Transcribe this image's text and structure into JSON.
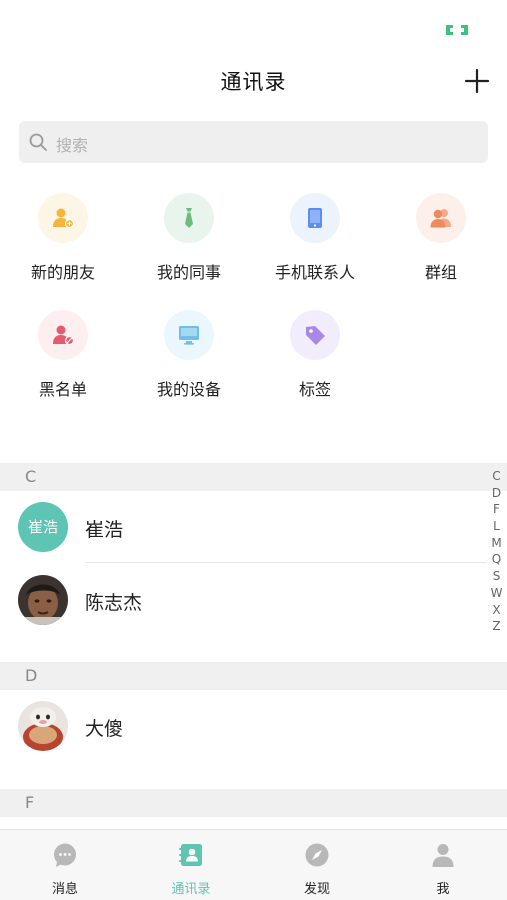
{
  "header": {
    "title": "通讯录"
  },
  "search": {
    "placeholder": "搜索"
  },
  "quick_grid": [
    {
      "label": "新的朋友",
      "icon": "new-friend-icon",
      "color": "#f5b43c",
      "bg": "#fdf6e6"
    },
    {
      "label": "我的同事",
      "icon": "colleague-tie-icon",
      "color": "#6fbb7e",
      "bg": "#e9f5ec"
    },
    {
      "label": "手机联系人",
      "icon": "phone-contacts-icon",
      "color": "#5b8ef0",
      "bg": "#edf3fd"
    },
    {
      "label": "群组",
      "icon": "group-icon",
      "color": "#ee8a5c",
      "bg": "#fdf0ea"
    },
    {
      "label": "黑名单",
      "icon": "blacklist-icon",
      "color": "#e65b6e",
      "bg": "#fdeef0"
    },
    {
      "label": "我的设备",
      "icon": "device-icon",
      "color": "#6fc0e8",
      "bg": "#ebf7fc"
    },
    {
      "label": "标签",
      "icon": "tag-icon",
      "color": "#a989e6",
      "bg": "#f2edfc"
    }
  ],
  "sections": [
    {
      "letter": "C",
      "contacts": [
        {
          "name": "崔浩",
          "avatar_text": "崔浩"
        },
        {
          "name": "陈志杰"
        }
      ]
    },
    {
      "letter": "D",
      "contacts": [
        {
          "name": "大傻"
        }
      ]
    },
    {
      "letter": "F",
      "contacts": []
    }
  ],
  "index_letters": [
    "C",
    "D",
    "F",
    "L",
    "M",
    "Q",
    "S",
    "W",
    "X",
    "Z"
  ],
  "tabs": [
    {
      "label": "消息",
      "icon": "chat-bubble-icon",
      "active": false
    },
    {
      "label": "通讯录",
      "icon": "contacts-book-icon",
      "active": true
    },
    {
      "label": "发现",
      "icon": "compass-icon",
      "active": false
    },
    {
      "label": "我",
      "icon": "person-icon",
      "active": false
    }
  ],
  "colors": {
    "accent": "#5ec4b3",
    "section_bg": "#f0f0f0",
    "search_bg": "#efefef"
  }
}
